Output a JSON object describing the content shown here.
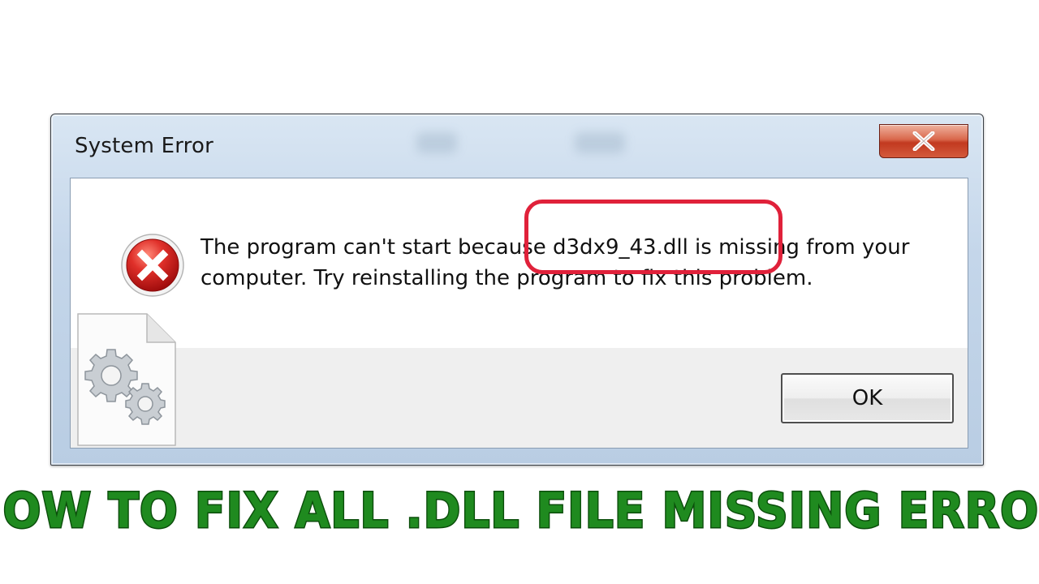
{
  "window": {
    "title": "System Error",
    "close_label": "X",
    "close_icon": "close-x-icon"
  },
  "dialog": {
    "icon": "error-x-icon",
    "message_line1": "The program can't start because d3dx9_43.dll is missing from your",
    "message_line2": "computer. Try reinstalling the program to fix this problem.",
    "highlighted_text": "d3dx9_43.dll is missing",
    "ok_label": "OK"
  },
  "overlay": {
    "file_icon": "dll-file-gears-icon"
  },
  "headline": {
    "text": "HOW TO FIX ALL .DLL FILE MISSING ERROR"
  },
  "colors": {
    "highlight_ring": "#e0213a",
    "headline_fill": "#1f8a1f",
    "headline_outline": "#0b4d0b",
    "error_red": "#d21f1f",
    "close_button_red": "#c2391f"
  }
}
